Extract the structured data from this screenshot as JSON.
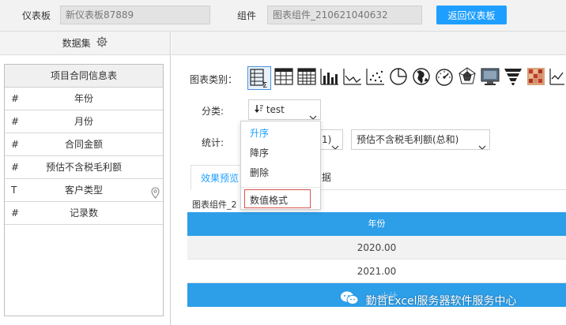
{
  "topbar": {
    "dashboard_label": "仪表板",
    "dashboard_value": "新仪表板87889",
    "component_label": "组件",
    "component_value": "图表组件_210621040632",
    "back_button": "返回仪表板",
    "accent_color": "#1e9fff"
  },
  "left_panel": {
    "header": "数据集",
    "table_title": "项目合同信息表",
    "fields": [
      {
        "type": "#",
        "name": "年份"
      },
      {
        "type": "#",
        "name": "月份"
      },
      {
        "type": "#",
        "name": "合同金额"
      },
      {
        "type": "#",
        "name": "预估不含税毛利额"
      },
      {
        "type": "T",
        "name": "客户类型",
        "icon": "location-pin-icon"
      },
      {
        "type": "#",
        "name": "记录数"
      }
    ]
  },
  "chart_config": {
    "chart_type_label": "图表类别：",
    "chart_type_icons": [
      "table-sum-icon",
      "table-icon",
      "table-grid-icon",
      "bar-chart-icon",
      "line-chart-icon",
      "scatter-chart-icon",
      "pie-chart-icon",
      "globe-icon",
      "gauge-icon",
      "radar-icon",
      "map-icon",
      "funnel-icon",
      "heatmap-icon",
      "line-chart-2-icon"
    ],
    "category_label": "分类:",
    "category_value": "test",
    "stats_label": "统计:",
    "stats_value_partial": "1)",
    "stats_value_2": "预估不含税毛利额(总和)"
  },
  "tabs": [
    {
      "label": "效果预览",
      "active": true
    },
    {
      "label": "据",
      "active": false
    }
  ],
  "preview": {
    "component_title": "图表组件_2",
    "column_header": "年份",
    "rows": [
      "2020.00",
      "2021.00"
    ],
    "footer_partial": "小计"
  },
  "dropdown_menu": {
    "items": [
      {
        "label": "升序",
        "active": true
      },
      {
        "label": "降序",
        "active": false
      },
      {
        "label": "删除",
        "active": false
      },
      {
        "label": "数值格式",
        "active": false,
        "highlighted": true
      }
    ]
  },
  "watermark": "勤哲Excel服务器软件服务中心"
}
